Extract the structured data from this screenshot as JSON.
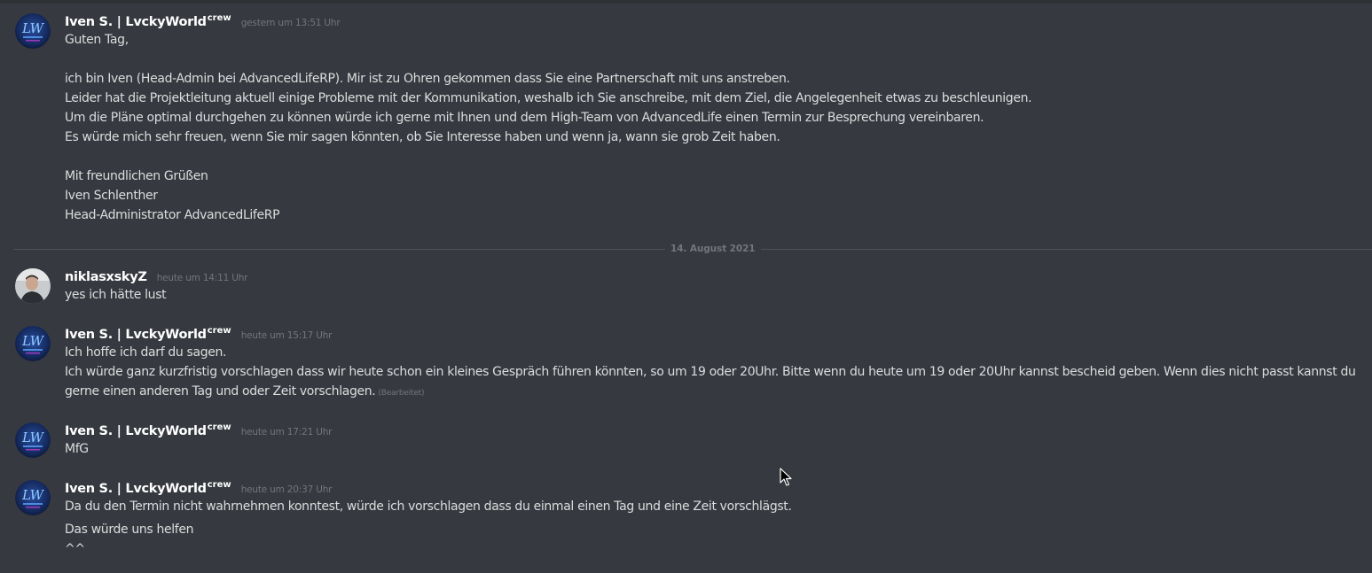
{
  "messages": [
    {
      "author": "Iven S. | LvckyWorld",
      "tag": "crew",
      "timestamp": "gestern um 13:51 Uhr",
      "lines": [
        "Guten Tag,",
        "",
        "ich bin Iven (Head-Admin bei AdvancedLifeRP). Mir ist zu Ohren gekommen dass Sie eine Partnerschaft mit uns anstreben.",
        "Leider hat die Projektleitung aktuell einige Probleme mit der Kommunikation, weshalb ich Sie anschreibe, mit dem Ziel, die Angelegenheit etwas zu beschleunigen.",
        "Um die Pläne optimal durchgehen zu können würde ich gerne mit Ihnen und dem High-Team von AdvancedLife einen Termin zur Besprechung vereinbaren.",
        "Es würde mich sehr freuen, wenn Sie mir sagen könnten, ob Sie Interesse haben und wenn ja, wann sie grob Zeit haben.",
        "",
        "Mit freundlichen Grüßen",
        "Iven Schlenther",
        "Head-Administrator AdvancedLifeRP"
      ]
    },
    {
      "author": "niklasxskyZ",
      "timestamp": "heute um 14:11 Uhr",
      "lines": [
        "yes ich hätte lust"
      ]
    },
    {
      "author": "Iven S. | LvckyWorld",
      "tag": "crew",
      "timestamp": "heute um 15:17 Uhr",
      "lines": [
        "Ich hoffe ich darf du sagen.",
        "Ich würde ganz kurzfristig vorschlagen dass wir heute schon ein kleines Gespräch führen könnten, so um 19 oder 20Uhr. Bitte wenn du heute um 19 oder 20Uhr kannst bescheid geben. Wenn dies nicht passt kannst du",
        "gerne einen anderen Tag und oder Zeit vorschlagen."
      ],
      "edited": "(Bearbeitet)"
    },
    {
      "author": "Iven S. | LvckyWorld",
      "tag": "crew",
      "timestamp": "heute um 17:21 Uhr",
      "lines": [
        "MfG"
      ]
    },
    {
      "author": "Iven S. | LvckyWorld",
      "tag": "crew",
      "timestamp": "heute um 20:37 Uhr",
      "lines": [
        "Da du den Termin nicht wahrnehmen konntest, würde ich vorschlagen dass du einmal einen Tag und eine Zeit vorschlägst.",
        "Das würde uns helfen",
        "^^"
      ]
    }
  ],
  "date_divider": "14. August 2021",
  "avatar_logo_text": "LW",
  "colors": {
    "background": "#36393f",
    "text": "#dcddde",
    "username": "#ffffff",
    "timestamp": "#72767d",
    "divider": "#4f545c"
  },
  "icons": {
    "cursor": "mouse-pointer-icon"
  }
}
